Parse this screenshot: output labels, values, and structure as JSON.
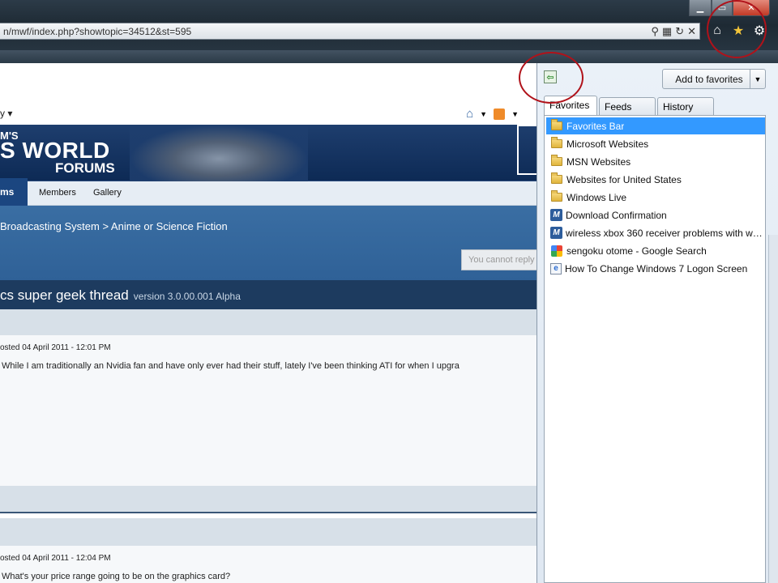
{
  "window": {
    "minimize": "▁",
    "maximize": "▭",
    "close": "✕"
  },
  "address": {
    "url": "n/mwf/index.php?showtopic=34512&st=595",
    "icons": [
      "search-icon",
      "compat-icon",
      "refresh-icon",
      "stop-icon"
    ]
  },
  "toolbar": {
    "icons": [
      "home-icon",
      "favorites-star-icon",
      "tools-gear-icon"
    ]
  },
  "page": {
    "nav_left": "y ▾",
    "banner_top": "M'S",
    "banner_main": "S WORLD",
    "banner_sub": "FORUMS",
    "tabs": {
      "active": "ms",
      "members": "Members",
      "gallery": "Gallery"
    },
    "breadcrumb": "Broadcasting System  >  Anime or Science Fiction",
    "cannot_reply": "You cannot reply",
    "topic_title": "cs super geek thread",
    "topic_version": "version 3.0.00.001 Alpha",
    "posts": [
      {
        "posted": "osted 04 April 2011 - 12:01 PM",
        "text": "While I am traditionally an Nvidia fan and have only ever had their stuff, lately I've been thinking ATI for when I upgra"
      },
      {
        "posted": "osted 04 April 2011 - 12:04 PM",
        "text": "What's your price range going to be on the graphics card?"
      }
    ]
  },
  "favorites_pane": {
    "add_button": "Add to favorites",
    "tabs": [
      "Favorites",
      "Feeds",
      "History"
    ],
    "items": [
      {
        "label": "Favorites Bar",
        "icon": "folder-icon",
        "selected": true
      },
      {
        "label": "Microsoft Websites",
        "icon": "folder-icon"
      },
      {
        "label": "MSN Websites",
        "icon": "folder-icon"
      },
      {
        "label": "Websites for United States",
        "icon": "folder-icon"
      },
      {
        "label": "Windows Live",
        "icon": "folder-icon"
      },
      {
        "label": "Download Confirmation",
        "icon": "msn-icon"
      },
      {
        "label": "wireless xbox 360 receiver problems with win...",
        "icon": "msn-icon"
      },
      {
        "label": "sengoku otome - Google Search",
        "icon": "google-icon"
      },
      {
        "label": "How To Change Windows 7 Logon Screen",
        "icon": "ie-page-icon"
      }
    ]
  }
}
